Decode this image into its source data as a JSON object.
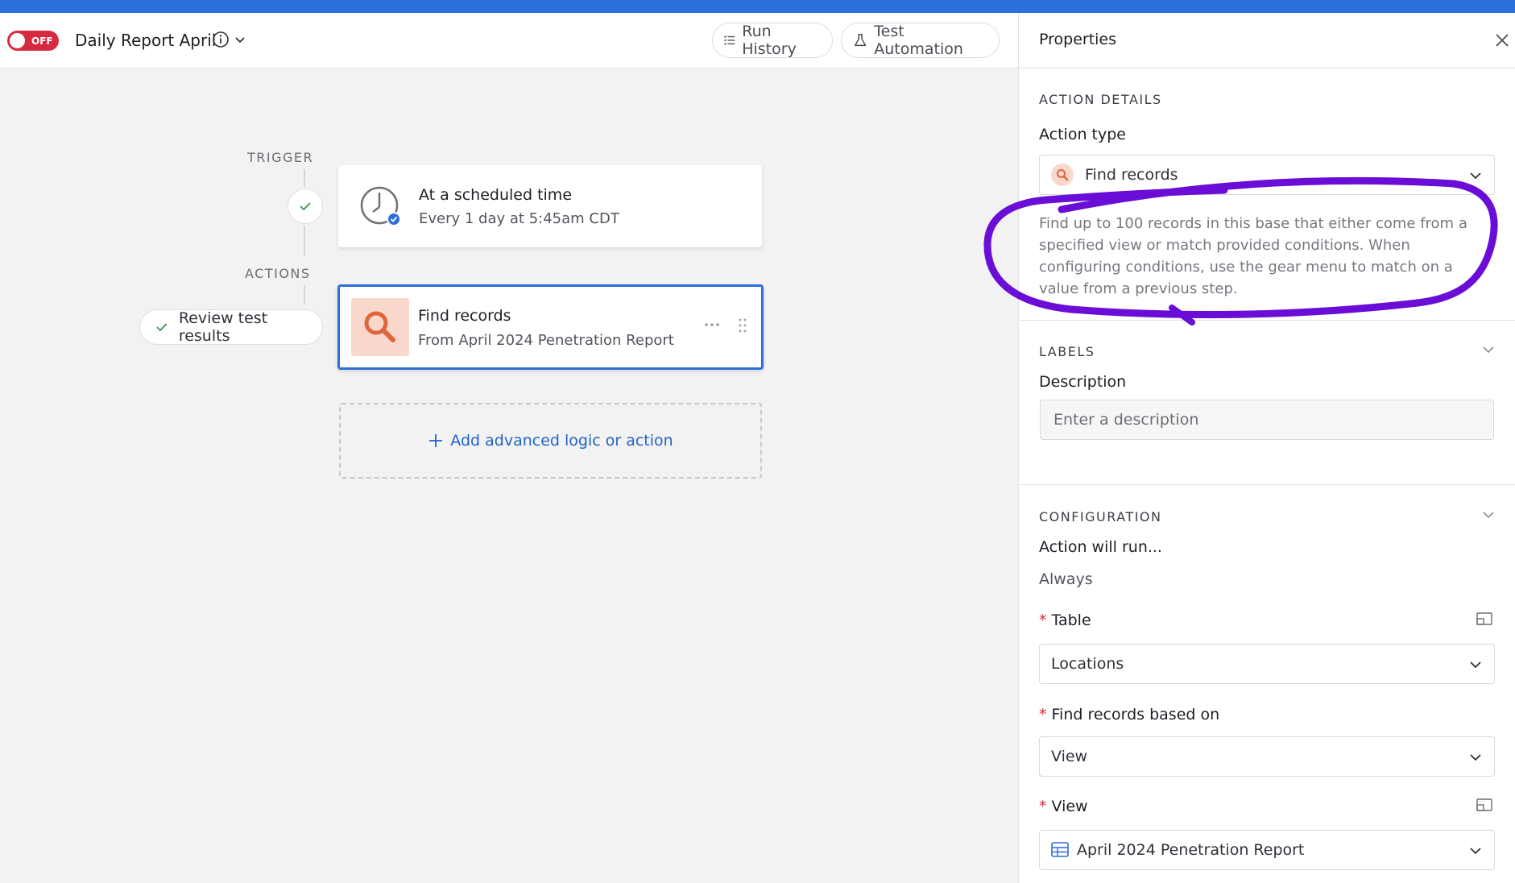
{
  "header": {
    "toggle_label": "OFF",
    "automation_name": "Daily Report April",
    "run_history_label": "Run History",
    "test_automation_label": "Test Automation"
  },
  "canvas": {
    "trigger_label": "TRIGGER",
    "actions_label": "ACTIONS",
    "trigger_card": {
      "title": "At a scheduled time",
      "subtitle": "Every 1 day at 5:45am CDT"
    },
    "action_card": {
      "title": "Find records",
      "subtitle": "From April 2024 Penetration Report"
    },
    "review_label": "Review test results",
    "add_label": "Add advanced logic or action"
  },
  "panel": {
    "title": "Properties",
    "action_details": {
      "caption": "ACTION DETAILS",
      "action_type_label": "Action type",
      "action_type_value": "Find records",
      "description": "Find up to 100 records in this base that either come from a specified view or match provided conditions. When configuring conditions, use the gear menu to match on a value from a previous step."
    },
    "labels": {
      "caption": "LABELS",
      "description_label": "Description",
      "description_placeholder": "Enter a description"
    },
    "configuration": {
      "caption": "CONFIGURATION",
      "run_label": "Action will run...",
      "run_value": "Always",
      "table_label": "Table",
      "table_value": "Locations",
      "find_based_label": "Find records based on",
      "find_based_value": "View",
      "view_label": "View",
      "view_value": "April 2024 Penetration Report"
    }
  },
  "colors": {
    "accent_blue": "#2d6fd8",
    "toggle_red": "#d62b3f",
    "find_orange": "#e0643c",
    "annotation_purple": "#6a0dd6"
  }
}
